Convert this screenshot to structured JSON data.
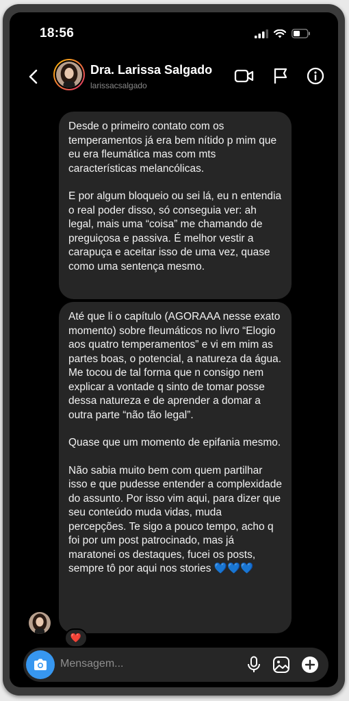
{
  "status_bar": {
    "time": "18:56"
  },
  "header": {
    "name": "Dra. Larissa Salgado",
    "username": "larissacsalgado",
    "icons": [
      "back-arrow-icon",
      "video-call-icon",
      "flag-icon",
      "info-icon"
    ]
  },
  "messages": [
    {
      "paragraphs": [
        "Desde o primeiro contato com os temperamentos já era bem nítido p mim que eu era fleumática mas com mts características melancólicas.",
        "E por algum bloqueio ou sei lá, eu n entendia o real poder disso, só conseguia ver: ah legal, mais uma “coisa” me chamando de preguiçosa e passiva. É melhor vestir a carapuça e aceitar isso de uma vez, quase como uma sentença mesmo."
      ]
    },
    {
      "paragraphs": [
        "Até que li o capítulo (AGORAAA nesse exato momento) sobre fleumáticos no livro “Elogio aos quatro temperamentos” e vi em mim as partes boas, o potencial, a natureza da água. Me tocou de tal forma que n consigo nem explicar a vontade q sinto de tomar posse dessa natureza e de aprender a domar a outra parte “não tão legal”.",
        "Quase que um momento de epifania mesmo.",
        "Não sabia muito bem com quem partilhar isso e que pudesse entender a complexidade do assunto. Por isso vim aqui, para dizer que seu conteúdo muda vidas, muda percepções. Te sigo a pouco tempo, acho q foi por um post patrocinado, mas já maratonei os destaques, fucei os posts, sempre tô por aqui nos stories 💙💙💙"
      ],
      "reaction": "❤️"
    }
  ],
  "composer": {
    "placeholder": "Mensagem...",
    "icons": [
      "camera-icon",
      "microphone-icon",
      "gallery-icon",
      "plus-icon"
    ]
  },
  "colors": {
    "background": "#000000",
    "bubble": "#262626",
    "accent": "#3797f0",
    "muted": "#8e8e8e"
  }
}
